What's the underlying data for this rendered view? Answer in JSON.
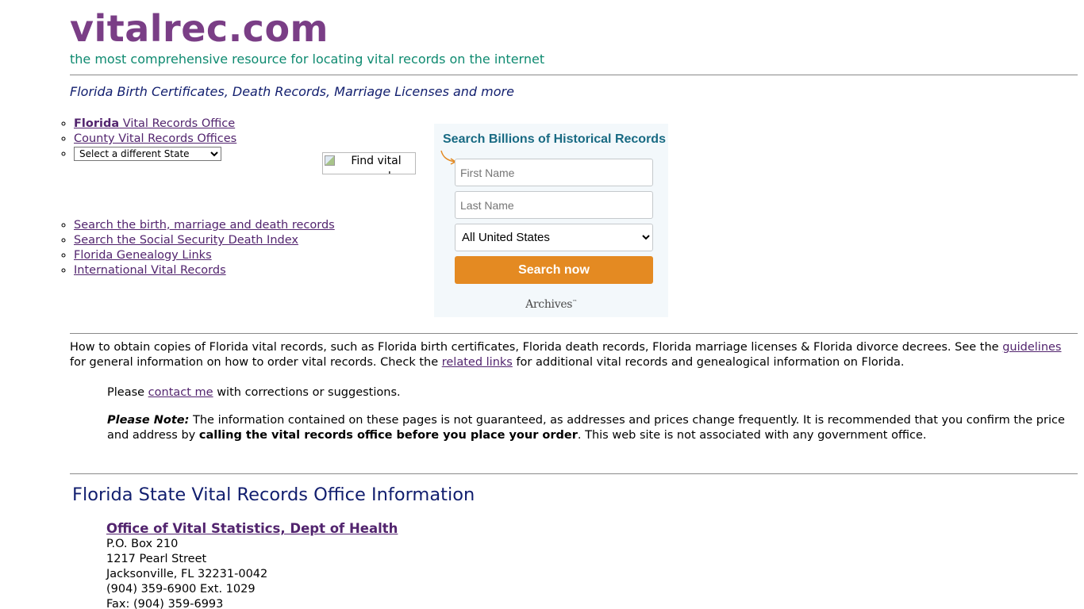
{
  "header": {
    "site_title": "vitalrec.com",
    "tagline": "the most comprehensive resource for locating vital records on the internet",
    "page_subtitle": "Florida Birth Certificates, Death Records, Marriage Licenses and more"
  },
  "nav_top": {
    "state_office_bold": "Florida",
    "state_office_rest": " Vital Records Office",
    "county_offices": "County Vital Records Offices",
    "state_select_value": "Select a different State"
  },
  "nav_bottom": {
    "search_records": "Search the birth, marriage and death records",
    "search_ssdi": "Search the Social Security Death Index",
    "genealogy_links": "Florida Genealogy Links",
    "international": "International Vital Records"
  },
  "broken_image": {
    "alt_text": "Find vital records online"
  },
  "search_widget": {
    "heading": "Search Billions of Historical Records",
    "first_name_placeholder": "First Name",
    "last_name_placeholder": "Last Name",
    "location_value": "All United States",
    "button_label": "Search now",
    "logo_text": "Archives",
    "logo_tm": "™",
    "accent_color": "#e48a22",
    "heading_color": "#186a83"
  },
  "intro": {
    "text1": "How to obtain copies of Florida vital records, such as Florida birth certificates, Florida death records, Florida marriage licenses & Florida divorce decrees. See the ",
    "guidelines_link": "guidelines",
    "text2": " for general information on how to order vital records. Check the ",
    "related_links_link": "related links",
    "text3": " for additional vital records and genealogical information on Florida."
  },
  "contact": {
    "prefix": "Please ",
    "link": "contact me",
    "suffix": " with corrections or suggestions."
  },
  "note": {
    "label": "Please Note:",
    "text1": " The information contained on these pages is not guaranteed, as addresses and prices change frequently. It is recommended that you confirm the price and address by ",
    "bold": "calling the vital records office before you place your order",
    "text2": ". This web site is not associated with any government office."
  },
  "office_section": {
    "heading": "Florida State Vital Records Office Information",
    "office_name": "Office of Vital Statistics, Dept of Health",
    "address_lines": [
      "P.O. Box 210",
      "1217 Pearl Street",
      "Jacksonville, FL 32231-0042",
      "(904) 359-6900 Ext. 1029",
      "Fax: (904) 359-6993"
    ]
  }
}
